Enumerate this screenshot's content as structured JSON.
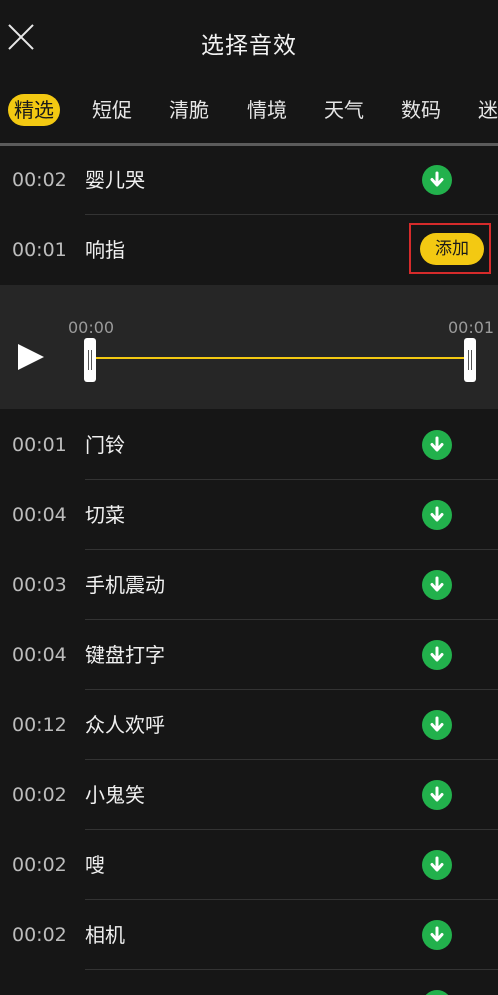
{
  "header": {
    "title": "选择音效"
  },
  "tabs": [
    "精选",
    "短促",
    "清脆",
    "情境",
    "天气",
    "数码",
    "迷"
  ],
  "rows": [
    {
      "time": "00:02",
      "name": "婴儿哭"
    },
    {
      "time": "00:01",
      "name": "响指",
      "action": "添加"
    },
    {
      "time": "00:01",
      "name": "门铃"
    },
    {
      "time": "00:04",
      "name": "切菜"
    },
    {
      "time": "00:03",
      "name": "手机震动"
    },
    {
      "time": "00:04",
      "name": "键盘打字"
    },
    {
      "time": "00:12",
      "name": "众人欢呼"
    },
    {
      "time": "00:02",
      "name": "小鬼笑"
    },
    {
      "time": "00:02",
      "name": "嗖"
    },
    {
      "time": "00:02",
      "name": "相机"
    }
  ],
  "player": {
    "start_time": "00:00",
    "end_time": "00:01"
  },
  "colors": {
    "accent": "#f3c912",
    "download": "#22b14c",
    "highlight": "#d62b2b"
  }
}
